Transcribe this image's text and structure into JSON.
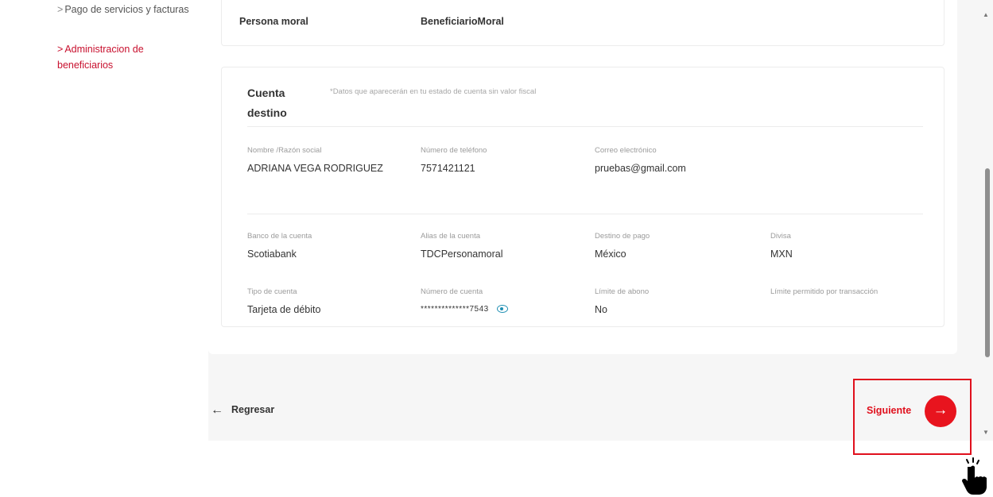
{
  "sidebar": {
    "items": [
      {
        "label": "Pago de servicios y facturas"
      },
      {
        "label": "Administracion de beneficiarios"
      }
    ]
  },
  "summary": {
    "type_label": "Persona moral",
    "type_value": "BeneficiarioMoral"
  },
  "destination": {
    "title": "Cuenta destino",
    "note": "*Datos que aparecerán en tu estado de cuenta sin valor fiscal",
    "fields": {
      "name": {
        "label": "Nombre /Razón social",
        "value": "ADRIANA VEGA RODRIGUEZ"
      },
      "phone": {
        "label": "Número de teléfono",
        "value": "7571421121"
      },
      "email": {
        "label": "Correo electrónico",
        "value": "pruebas@gmail.com"
      },
      "bank": {
        "label": "Banco de la cuenta",
        "value": "Scotiabank"
      },
      "alias": {
        "label": "Alias de la cuenta",
        "value": "TDCPersonamoral"
      },
      "dest": {
        "label": "Destino de pago",
        "value": "México"
      },
      "currency": {
        "label": "Divisa",
        "value": "MXN"
      },
      "acct_type": {
        "label": "Tipo de cuenta",
        "value": "Tarjeta de débito"
      },
      "acct_number": {
        "label": "Número de cuenta",
        "value": "**************7543"
      },
      "deposit_limit": {
        "label": "Límite de abono",
        "value": "No"
      },
      "tx_limit": {
        "label": "Límite permitido por transacción",
        "value": ""
      }
    }
  },
  "footer": {
    "back_label": "Regresar",
    "next_label": "Siguiente"
  },
  "icons": {
    "back": "arrow-left-icon",
    "next": "arrow-right-icon",
    "reveal": "eye-icon",
    "pointer": "hand-pointer-icon"
  },
  "colors": {
    "accent": "#e8141e",
    "link": "#1f8fb3"
  }
}
